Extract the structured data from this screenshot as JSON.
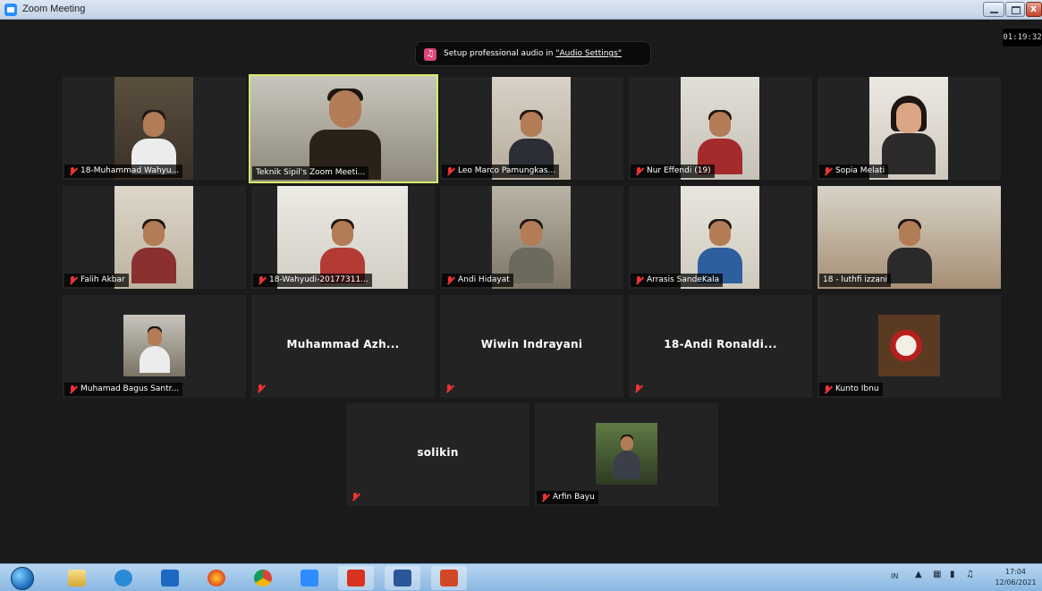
{
  "window": {
    "title": "Zoom Meeting"
  },
  "timer": "01:19:32",
  "banner": {
    "text": "Setup professional audio in ",
    "link": "\"Audio Settings\""
  },
  "tiles": [
    {
      "name": "18-Muhammad Wahyu...",
      "active": false,
      "muted": true
    },
    {
      "name": "Teknik Sipil's Zoom Meeti...",
      "active": true,
      "muted": false
    },
    {
      "name": "Leo Marco Pamungkas...",
      "active": false,
      "muted": true
    },
    {
      "name": "Nur Effendi (19)",
      "active": false,
      "muted": true
    },
    {
      "name": "Sopia Melati",
      "active": false,
      "muted": true
    },
    {
      "name": "Falih Akbar",
      "active": false,
      "muted": true
    },
    {
      "name": "18-Wahyudi-20177311...",
      "active": false,
      "muted": true
    },
    {
      "name": "Andi Hidayat",
      "active": false,
      "muted": true
    },
    {
      "name": "Arrasis SandeKala",
      "active": false,
      "muted": true
    },
    {
      "name": "18 - luthfi izzani",
      "active": false,
      "muted": false
    },
    {
      "name": "Muhamad Bagus Santr...",
      "active": false,
      "muted": true
    },
    {
      "name": "Muhammad Azh...",
      "active": false,
      "muted": true
    },
    {
      "name": "Wiwin Indrayani",
      "active": false,
      "muted": true
    },
    {
      "name": "18-Andi Ronaldi...",
      "active": false,
      "muted": true
    },
    {
      "name": "Kunto Ibnu",
      "active": false,
      "muted": true
    },
    {
      "name": "solikin",
      "active": false,
      "muted": true
    },
    {
      "name": "Arfin Bayu",
      "active": false,
      "muted": true
    }
  ],
  "taskbar": {
    "items": [
      "start-orb",
      "explorer",
      "internet-explorer",
      "outlook",
      "firefox",
      "chrome",
      "zoom",
      "acrobat",
      "word",
      "powerpoint"
    ],
    "tray": {
      "lang": "IN",
      "time": "17:04",
      "date": "12/06/2021"
    }
  }
}
